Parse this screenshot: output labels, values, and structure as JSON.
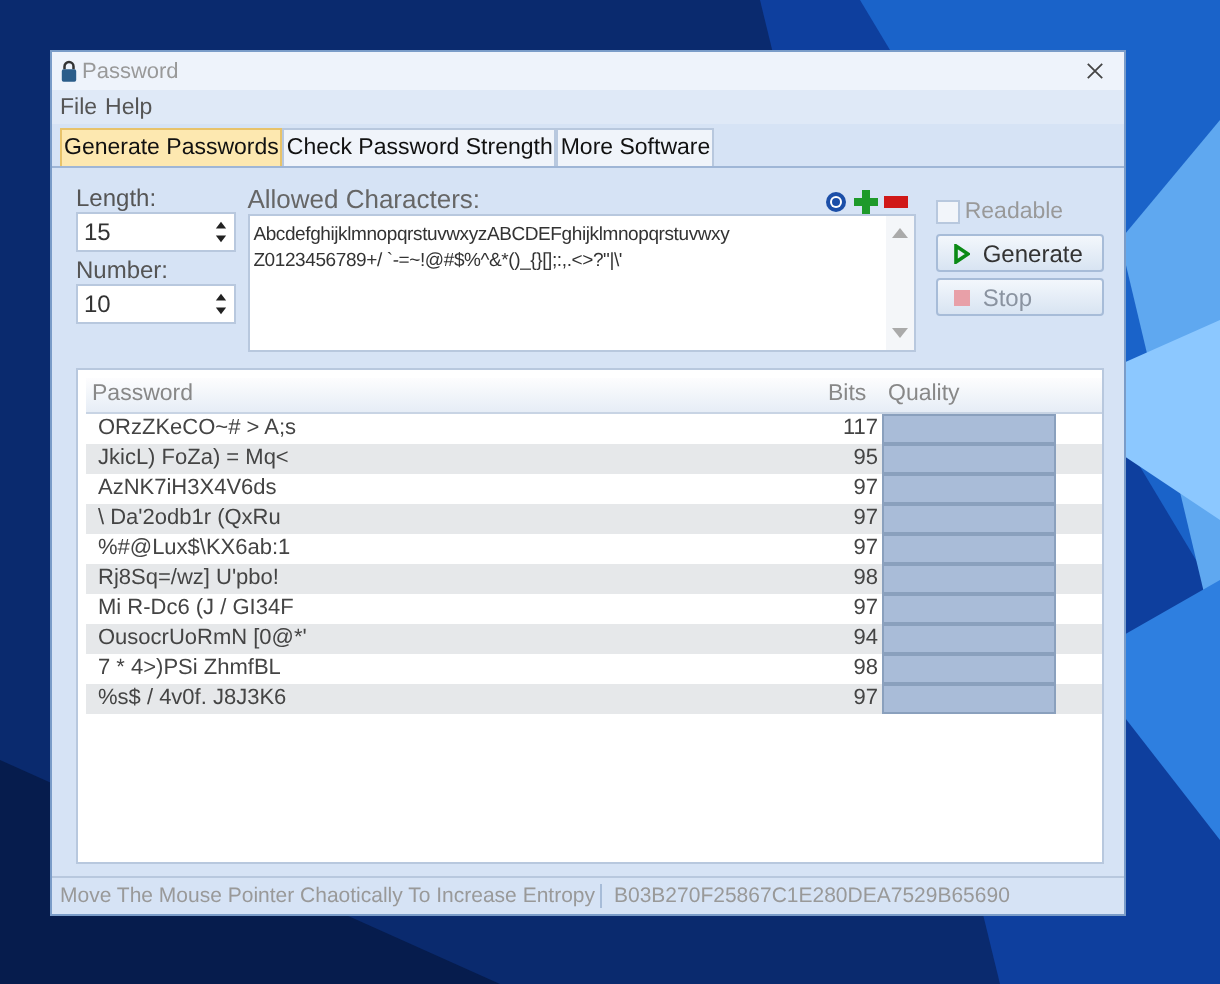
{
  "window": {
    "title": "Password"
  },
  "menu": [
    "File",
    "Help"
  ],
  "tabs": [
    {
      "label": "Generate Passwords",
      "selected": true
    },
    {
      "label": "Check Password Strength",
      "selected": false
    },
    {
      "label": "More Software",
      "selected": false
    }
  ],
  "length": {
    "label": "Length:",
    "value": "15"
  },
  "number": {
    "label": "Number:",
    "value": "10"
  },
  "allowed": {
    "label": "Allowed Characters:",
    "lines": [
      "AbcdefghijklmnopqrstuvwxyzABCDEFghijklmnopqrstuvwxy",
      "Z0123456789+/ `-=~!@#$%^&*()_{}[];:,.<>?\"|\\'"
    ]
  },
  "readable": {
    "label": "Readable",
    "checked": false
  },
  "buttons": [
    {
      "label": "Generate",
      "kind": "play",
      "disabled": false
    },
    {
      "label": "Stop",
      "kind": "stop",
      "disabled": true
    }
  ],
  "table": {
    "columns": [
      "Password",
      "Bits",
      "Quality"
    ],
    "rows": [
      {
        "password": "ORzZKeCO~# > A;s",
        "bits": "117",
        "level": 1
      },
      {
        "password": "JkicL) FoZa) = Mq<",
        "bits": "95",
        "level": 1
      },
      {
        "password": "AzNK7iH3X4V6ds",
        "bits": "97",
        "level": 1
      },
      {
        "password": "\\ Da'2odb1r (QxRu",
        "bits": "97",
        "level": 1
      },
      {
        "password": "%#@Lux$\\KX6ab:1",
        "bits": "97",
        "level": 1
      },
      {
        "password": "Rj8Sq=/wz] U'pbo!",
        "bits": "98",
        "level": 1
      },
      {
        "password": "Mi R-Dc6 (J / GI34F",
        "bits": "97",
        "level": 1
      },
      {
        "password": "OusocrUoRmN [0@*'",
        "bits": "94",
        "level": 1
      },
      {
        "password": "7 * 4>)PSi ZhmfBL",
        "bits": "98",
        "level": 1
      },
      {
        "password": "%s$ / 4v0f. J8J3K6",
        "bits": "97",
        "level": 1
      }
    ]
  },
  "status_bar": [
    "Move The Mouse Pointer Chaotically To Increase Entropy",
    "B03B270F25867C1E280DEA7529B65690"
  ]
}
